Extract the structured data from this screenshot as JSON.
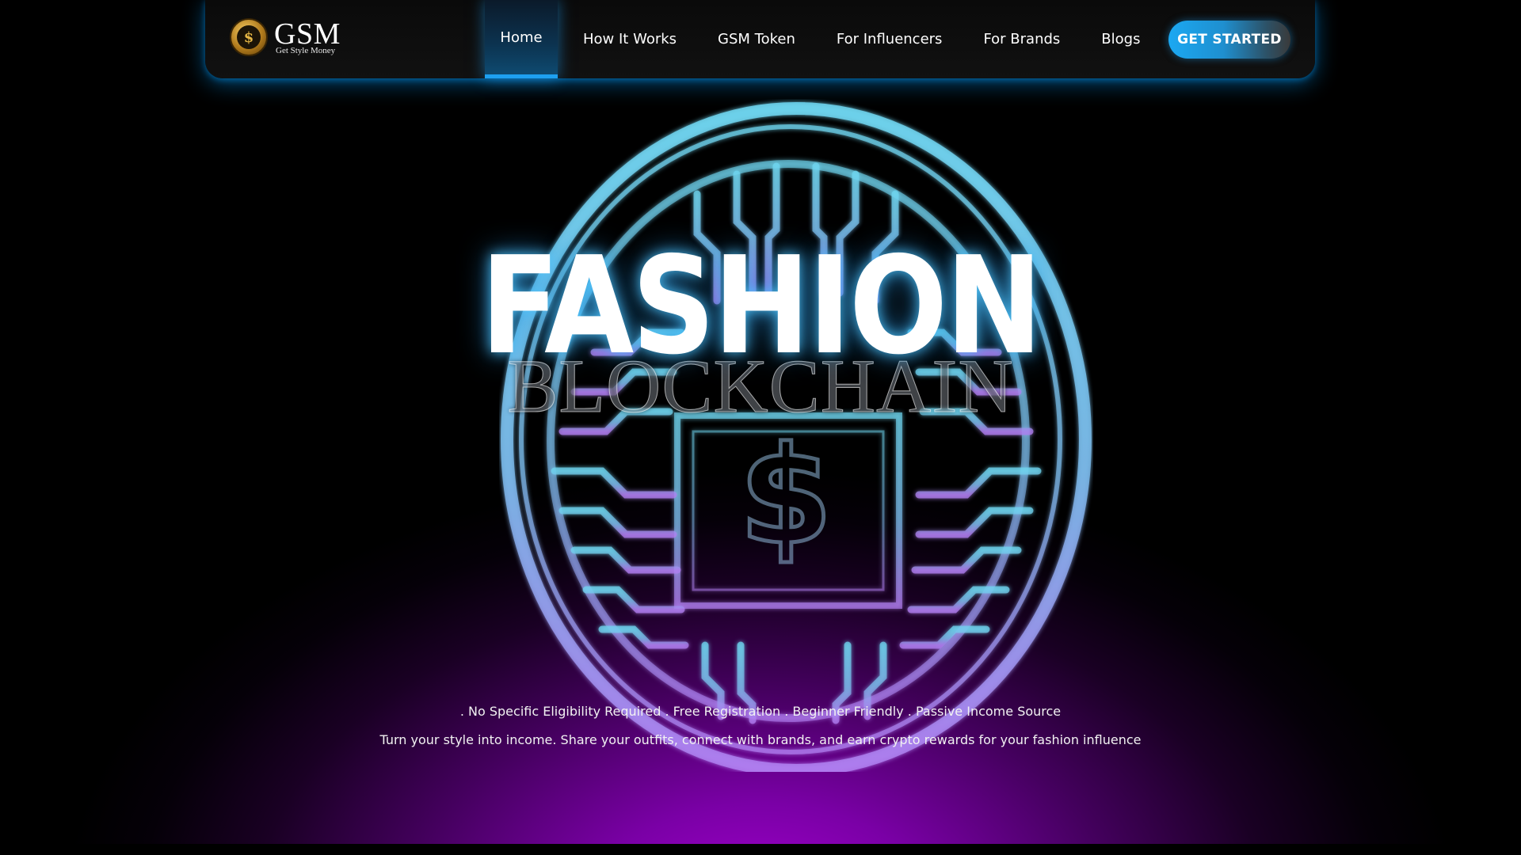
{
  "brand": {
    "title": "GSM",
    "subtitle": "Get Style Money",
    "coin_symbol": "$"
  },
  "nav": {
    "items": [
      {
        "label": "Home",
        "active": true
      },
      {
        "label": "How It Works",
        "active": false
      },
      {
        "label": "GSM Token",
        "active": false
      },
      {
        "label": "For Influencers",
        "active": false
      },
      {
        "label": "For Brands",
        "active": false
      },
      {
        "label": "Blogs",
        "active": false
      }
    ],
    "cta_label": "GET STARTED"
  },
  "hero": {
    "headline": "FASHION",
    "subheadline": "BLOCKCHAIN",
    "coin_symbol": "$",
    "features": ". No Specific Eligibility Required . Free Registration . Beginner Friendly . Passive Income Source",
    "tagline": "Turn your style into income. Share your outfits, connect with brands, and earn crypto rewards for your fashion influence"
  },
  "colors": {
    "accent": "#1ea0f0",
    "glow": "#50c8ff",
    "hero_purple": "#a400cf"
  },
  "icons": {
    "logo": "gold-coin-dollar-icon",
    "hero": "circuit-coin-icon"
  }
}
